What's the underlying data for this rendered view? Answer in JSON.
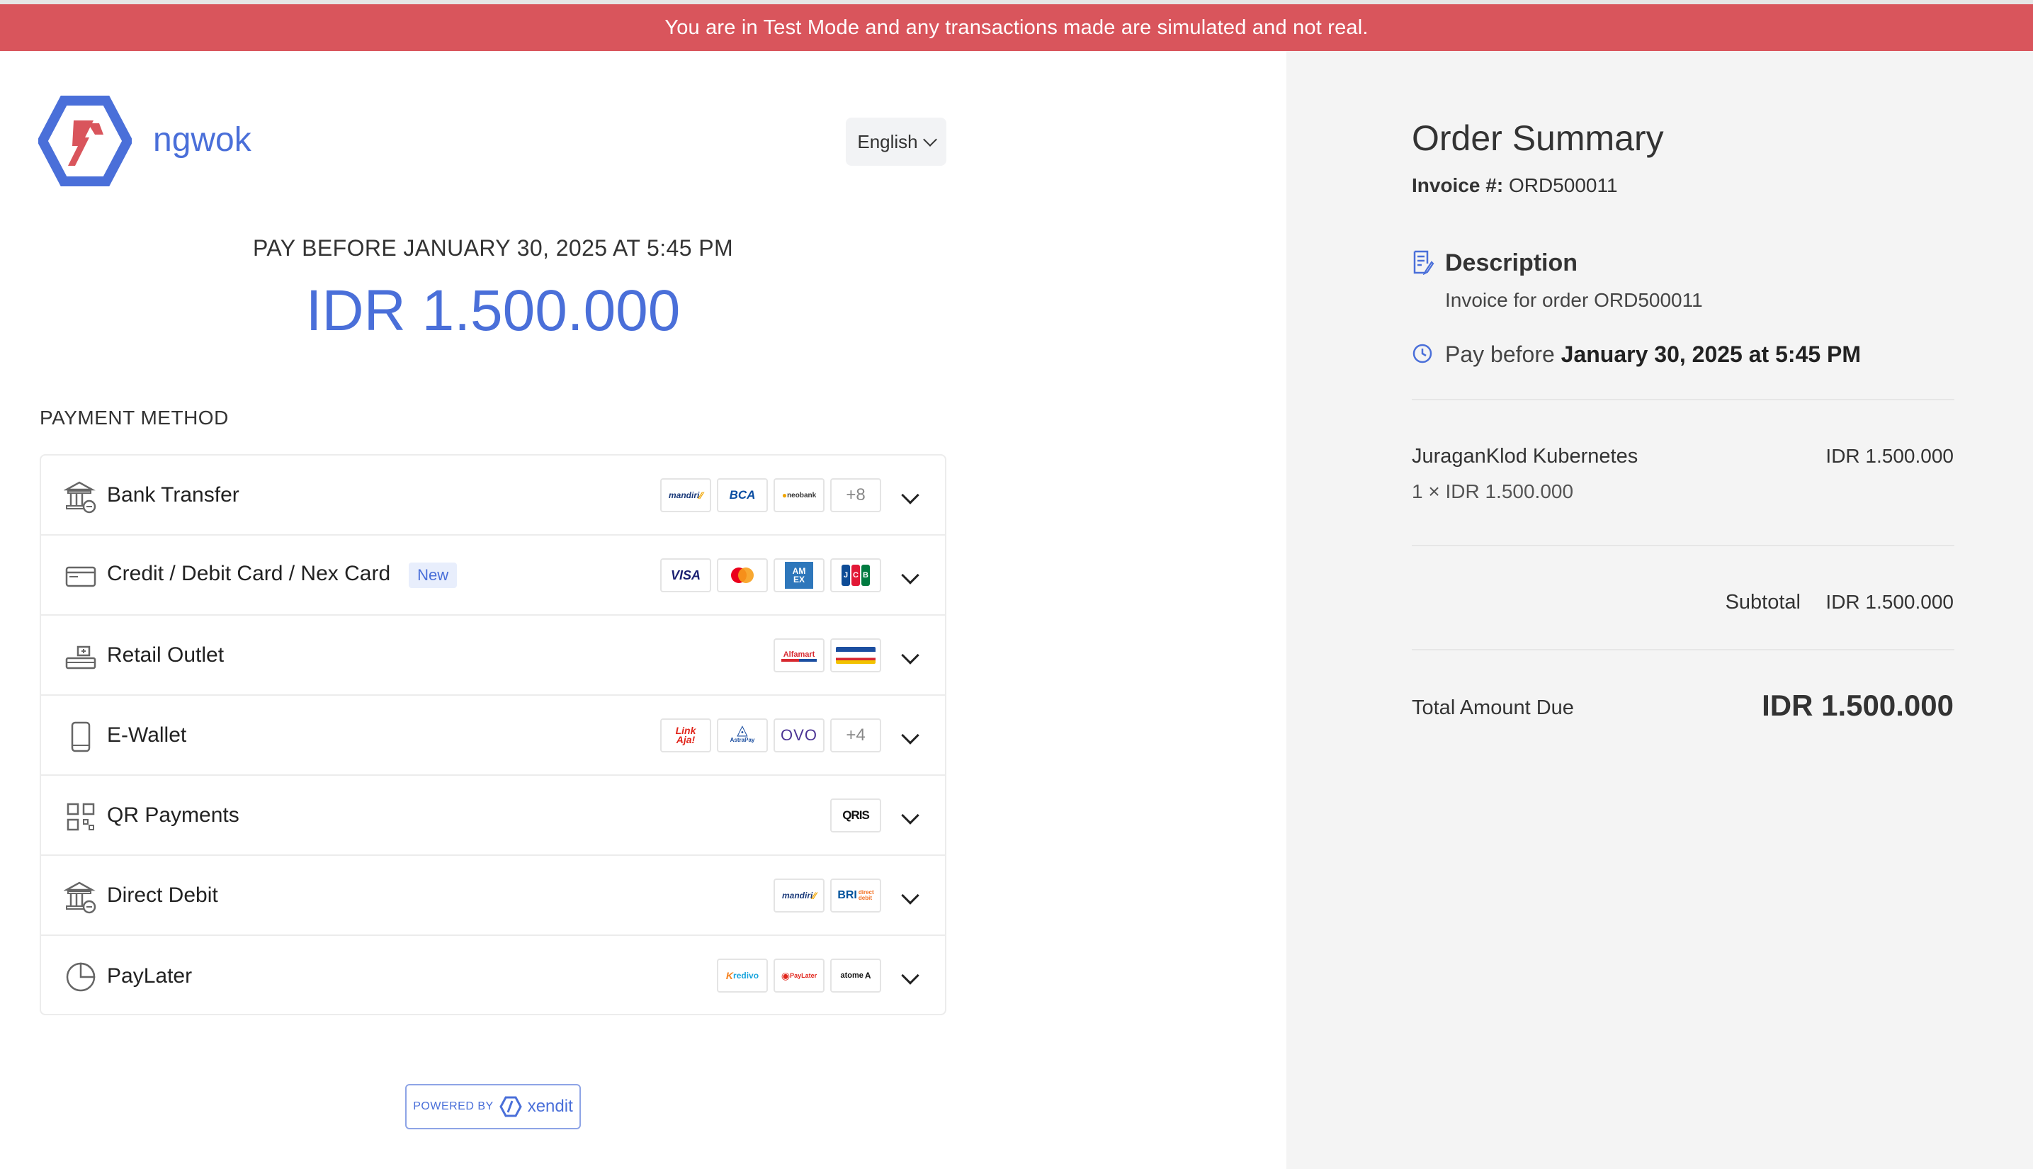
{
  "banner": {
    "text": "You are in Test Mode and any transactions made are simulated and not real."
  },
  "merchant": {
    "name": "ngwok",
    "logo_icon": "ngwok-logo"
  },
  "language": {
    "selected": "English"
  },
  "payment": {
    "pay_before": "PAY BEFORE JANUARY 30, 2025 AT 5:45 PM",
    "amount": "IDR 1.500.000",
    "method_heading": "PAYMENT METHOD",
    "methods": [
      {
        "label": "Bank Transfer",
        "icon": "bank-icon",
        "logos": [
          "mandiri",
          "BCA",
          "neobank"
        ],
        "more": "+8"
      },
      {
        "label": "Credit / Debit Card / Nex Card",
        "icon": "card-icon",
        "badge": "New",
        "logos": [
          "VISA",
          "mastercard",
          "AMEX",
          "JCB"
        ]
      },
      {
        "label": "Retail Outlet",
        "icon": "store-icon",
        "logos": [
          "Alfamart",
          "Indomaret"
        ]
      },
      {
        "label": "E-Wallet",
        "icon": "phone-icon",
        "logos": [
          "LinkAja!",
          "AstraPay",
          "OVO"
        ],
        "more": "+4"
      },
      {
        "label": "QR Payments",
        "icon": "qr-icon",
        "logos": [
          "QRIS"
        ]
      },
      {
        "label": "Direct Debit",
        "icon": "bank-icon",
        "logos": [
          "mandiri",
          "BRI"
        ]
      },
      {
        "label": "PayLater",
        "icon": "pie-icon",
        "logos": [
          "Kredivo",
          "PayLater",
          "atome"
        ]
      }
    ]
  },
  "powered_by": {
    "prefix": "POWERED BY",
    "brand": "xendit"
  },
  "summary": {
    "title": "Order Summary",
    "invoice_label": "Invoice #:",
    "invoice_number": "ORD500011",
    "description_title": "Description",
    "description_text": "Invoice for order ORD500011",
    "due_prefix": "Pay before",
    "due_date": "January 30, 2025 at 5:45 PM",
    "item_name": "JuraganKlod Kubernetes",
    "item_price": "IDR 1.500.000",
    "item_qty": "1 × IDR 1.500.000",
    "subtotal_label": "Subtotal",
    "subtotal_value": "IDR 1.500.000",
    "total_label": "Total Amount Due",
    "total_value": "IDR 1.500.000"
  },
  "colors": {
    "accent": "#4a6fd9",
    "banner": "#d9555c",
    "logo_red": "#d9555c"
  }
}
